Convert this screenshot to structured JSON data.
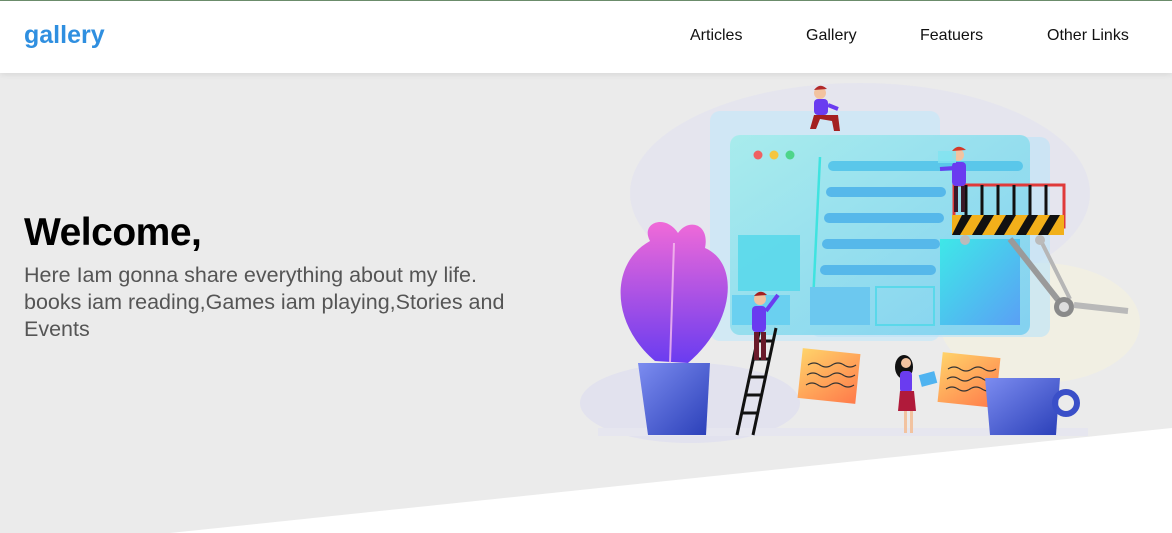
{
  "header": {
    "logo": "gallery",
    "nav": [
      "Articles",
      "Gallery",
      "Featuers",
      "Other Links"
    ]
  },
  "hero": {
    "title": "Welcome,",
    "description": "Here Iam gonna share everything about my life. books iam reading,Games iam playing,Stories and Events"
  },
  "colors": {
    "brand": "#2f8fe0",
    "hero_bg": "#ebebeb",
    "text_muted": "#555555"
  },
  "illustration": {
    "icon": "website-builders-illustration"
  }
}
